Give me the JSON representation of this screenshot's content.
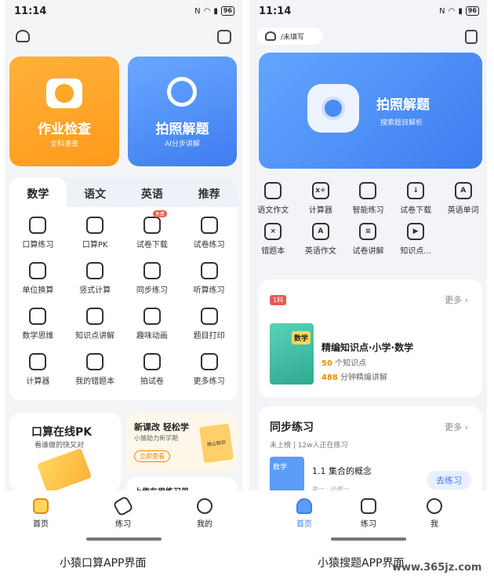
{
  "left": {
    "status": {
      "time": "11:14",
      "battery": "96"
    },
    "card_homework": {
      "title": "作业检查",
      "subtitle": "全科速查"
    },
    "card_photo": {
      "title": "拍照解题",
      "subtitle": "AI分步讲解"
    },
    "tabs": [
      "数学",
      "语文",
      "英语",
      "推荐"
    ],
    "grid": [
      {
        "label": "口算练习",
        "icon": "pencil-check-icon"
      },
      {
        "label": "口算PK",
        "icon": "pk-screen-icon"
      },
      {
        "label": "试卷下载",
        "icon": "download-icon",
        "badge": "免费"
      },
      {
        "label": "试卷练习",
        "icon": "paper-icon"
      },
      {
        "label": "单位换算",
        "icon": "ruler-icon"
      },
      {
        "label": "竖式计算",
        "icon": "calc-pencil-icon"
      },
      {
        "label": "同步练习",
        "icon": "sync-book-icon"
      },
      {
        "label": "听算练习",
        "icon": "sound-icon"
      },
      {
        "label": "数学思维",
        "icon": "brain-icon"
      },
      {
        "label": "知识点讲解",
        "icon": "video-icon"
      },
      {
        "label": "趣味动画",
        "icon": "play-icon"
      },
      {
        "label": "题目打印",
        "icon": "printer-icon"
      },
      {
        "label": "计算器",
        "icon": "calculator-icon"
      },
      {
        "label": "我的错题本",
        "icon": "notebook-icon"
      },
      {
        "label": "拍试卷",
        "icon": "camera-icon"
      },
      {
        "label": "更多练习",
        "icon": "more-icon"
      }
    ],
    "promo_pk": {
      "title": "口算在线PK",
      "subtitle": "看谁做的快又对"
    },
    "promo_course": {
      "title": "新课改 轻松学",
      "subtitle": "小猿助力新学期",
      "button": "立即查看",
      "book": "核心知识"
    },
    "promo_peek": "上传在用练习册",
    "tabbar": [
      "首页",
      "练习",
      "我的"
    ]
  },
  "right": {
    "status": {
      "time": "11:14",
      "battery": "96"
    },
    "grade": "/未填写",
    "hero": {
      "title": "拍照解题",
      "subtitle": "搜索题目解析"
    },
    "grid": [
      {
        "label": "语文作文",
        "icon": "essay-icon",
        "glyph": ""
      },
      {
        "label": "计算器",
        "icon": "calculator-icon",
        "glyph": "x÷"
      },
      {
        "label": "智能练习",
        "icon": "book-icon",
        "glyph": ""
      },
      {
        "label": "试卷下载",
        "icon": "download-icon",
        "glyph": "↓"
      },
      {
        "label": "英语单词",
        "icon": "word-icon",
        "glyph": "A"
      },
      {
        "label": "错题本",
        "icon": "mistake-icon",
        "glyph": "×"
      },
      {
        "label": "英语作文",
        "icon": "english-essay-icon",
        "glyph": "A"
      },
      {
        "label": "试卷讲解",
        "icon": "paper-explain-icon",
        "glyph": "≡"
      },
      {
        "label": "知识点...",
        "icon": "knowledge-icon",
        "glyph": "▶"
      }
    ],
    "knowledge": {
      "tag": "1科",
      "more": "更多",
      "cover": "数学",
      "title": "精编知识点·小学·数学",
      "count": "50",
      "count_unit": "个知识点",
      "minutes": "488",
      "minutes_unit": "分钟精编讲解"
    },
    "sync": {
      "title": "同步练习",
      "more": "更多",
      "meta1": "未上榜",
      "meta2": "12w人正在练习",
      "cover": "数学",
      "item_title": "1.1 集合的概念",
      "item_sub": "高一 · 必修一",
      "button": "去练习"
    },
    "tabbar": [
      "首页",
      "练习",
      "我"
    ]
  },
  "captions": {
    "left": "小猿口算APP界面",
    "right": "小猿搜题APP界面",
    "watermark": "www.365jz.com"
  },
  "colors": {
    "orange": "#ffa726",
    "blue": "#4a8cf7",
    "accent_blue": "#3d7df0"
  }
}
